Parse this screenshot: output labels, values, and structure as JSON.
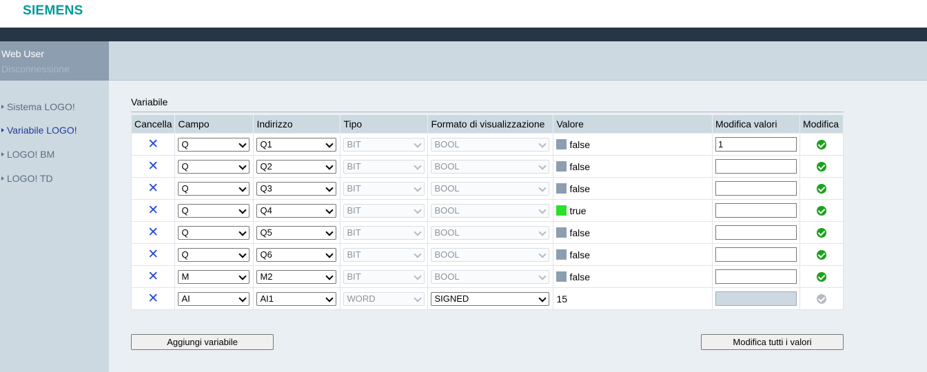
{
  "brand": "SIEMENS",
  "user": {
    "name": "Web User",
    "logout": "Disconnessione"
  },
  "nav": [
    {
      "label": "Sistema LOGO!",
      "active": false
    },
    {
      "label": "Variabile LOGO!",
      "active": true
    },
    {
      "label": "LOGO! BM",
      "active": false
    },
    {
      "label": "LOGO! TD",
      "active": false
    }
  ],
  "section_title": "Variabile",
  "columns": [
    "Cancella",
    "Campo",
    "Indirizzo",
    "Tipo",
    "Formato di visualizzazione",
    "Valore",
    "Modifica valori",
    "Modifica"
  ],
  "rows": [
    {
      "campo": "Q",
      "indirizzo": "Q1",
      "tipo": "BIT",
      "formato": "BOOL",
      "valore": "false",
      "state": "off",
      "modifica": "1",
      "formato_enabled": false,
      "editable": true
    },
    {
      "campo": "Q",
      "indirizzo": "Q2",
      "tipo": "BIT",
      "formato": "BOOL",
      "valore": "false",
      "state": "off",
      "modifica": "",
      "formato_enabled": false,
      "editable": true
    },
    {
      "campo": "Q",
      "indirizzo": "Q3",
      "tipo": "BIT",
      "formato": "BOOL",
      "valore": "false",
      "state": "off",
      "modifica": "",
      "formato_enabled": false,
      "editable": true
    },
    {
      "campo": "Q",
      "indirizzo": "Q4",
      "tipo": "BIT",
      "formato": "BOOL",
      "valore": "true",
      "state": "on",
      "modifica": "",
      "formato_enabled": false,
      "editable": true
    },
    {
      "campo": "Q",
      "indirizzo": "Q5",
      "tipo": "BIT",
      "formato": "BOOL",
      "valore": "false",
      "state": "off",
      "modifica": "",
      "formato_enabled": false,
      "editable": true
    },
    {
      "campo": "Q",
      "indirizzo": "Q6",
      "tipo": "BIT",
      "formato": "BOOL",
      "valore": "false",
      "state": "off",
      "modifica": "",
      "formato_enabled": false,
      "editable": true
    },
    {
      "campo": "M",
      "indirizzo": "M2",
      "tipo": "BIT",
      "formato": "BOOL",
      "valore": "false",
      "state": "off",
      "modifica": "",
      "formato_enabled": false,
      "editable": true
    },
    {
      "campo": "AI",
      "indirizzo": "AI1",
      "tipo": "WORD",
      "formato": "SIGNED",
      "valore": "15",
      "state": "none",
      "modifica": "",
      "formato_enabled": true,
      "editable": false
    }
  ],
  "buttons": {
    "add": "Aggiungi variabile",
    "modify_all": "Modifica tutti i valori"
  },
  "icons": {
    "delete": "close-x-icon",
    "apply": "check-circle-icon",
    "dropdown": "chevron-down-icon"
  },
  "colors": {
    "brand": "#009999",
    "header_dark": "#263645",
    "on": "#2be02b",
    "off": "#8c9eaf",
    "delete": "#2349d6",
    "apply": "#1aa21a"
  }
}
